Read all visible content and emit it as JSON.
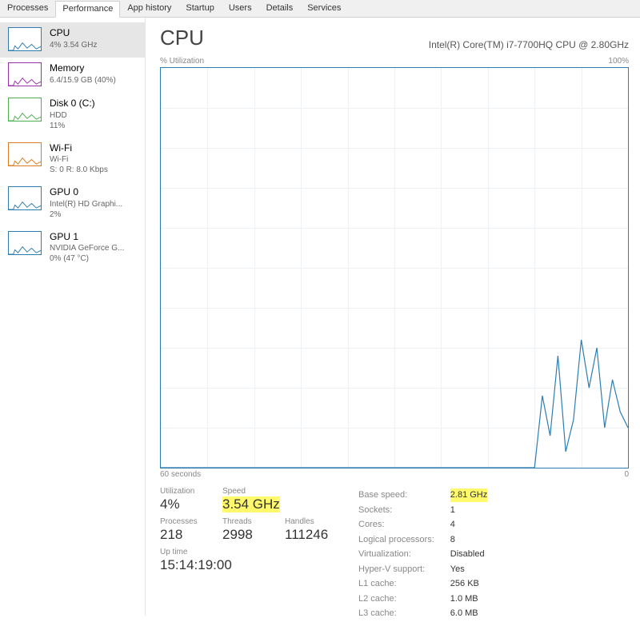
{
  "tabs": [
    "Processes",
    "Performance",
    "App history",
    "Startup",
    "Users",
    "Details",
    "Services"
  ],
  "activeTab": 1,
  "sidebar": [
    {
      "title": "CPU",
      "sub1": "4% 3.54 GHz",
      "sub2": "",
      "color": "#2c7db1"
    },
    {
      "title": "Memory",
      "sub1": "6.4/15.9 GB (40%)",
      "sub2": "",
      "color": "#9b2fae"
    },
    {
      "title": "Disk 0 (C:)",
      "sub1": "HDD",
      "sub2": "11%",
      "color": "#4caf50"
    },
    {
      "title": "Wi-Fi",
      "sub1": "Wi-Fi",
      "sub2": "S: 0 R: 8.0 Kbps",
      "color": "#d97b1e"
    },
    {
      "title": "GPU 0",
      "sub1": "Intel(R) HD Graphi...",
      "sub2": "2%",
      "color": "#2c7db1"
    },
    {
      "title": "GPU 1",
      "sub1": "NVIDIA GeForce G...",
      "sub2": "0% (47 °C)",
      "color": "#2c7db1"
    }
  ],
  "header": {
    "title": "CPU",
    "model": "Intel(R) Core(TM) i7-7700HQ CPU @ 2.80GHz"
  },
  "graph": {
    "ylabel": "% Utilization",
    "ymax": "100%",
    "xlabel_left": "60 seconds",
    "xlabel_right": "0"
  },
  "chart_data": {
    "type": "line",
    "title": "CPU % Utilization",
    "xlabel": "seconds ago",
    "ylabel": "% Utilization",
    "xlim": [
      60,
      0
    ],
    "ylim": [
      0,
      100
    ],
    "x": [
      60,
      12,
      11,
      10,
      9,
      8,
      7,
      6,
      5,
      4,
      3,
      2,
      1,
      0
    ],
    "values": [
      0,
      0,
      18,
      8,
      28,
      4,
      12,
      32,
      20,
      30,
      10,
      22,
      14,
      10
    ]
  },
  "stats": {
    "utilization": {
      "label": "Utilization",
      "value": "4%"
    },
    "speed": {
      "label": "Speed",
      "value": "3.54 GHz"
    },
    "processes": {
      "label": "Processes",
      "value": "218"
    },
    "threads": {
      "label": "Threads",
      "value": "2998"
    },
    "handles": {
      "label": "Handles",
      "value": "111246"
    },
    "uptime": {
      "label": "Up time",
      "value": "15:14:19:00"
    }
  },
  "details": [
    {
      "k": "Base speed:",
      "v": "2.81 GHz",
      "hl": true
    },
    {
      "k": "Sockets:",
      "v": "1"
    },
    {
      "k": "Cores:",
      "v": "4"
    },
    {
      "k": "Logical processors:",
      "v": "8"
    },
    {
      "k": "Virtualization:",
      "v": "Disabled"
    },
    {
      "k": "Hyper-V support:",
      "v": "Yes"
    },
    {
      "k": "L1 cache:",
      "v": "256 KB"
    },
    {
      "k": "L2 cache:",
      "v": "1.0 MB"
    },
    {
      "k": "L3 cache:",
      "v": "6.0 MB"
    }
  ]
}
